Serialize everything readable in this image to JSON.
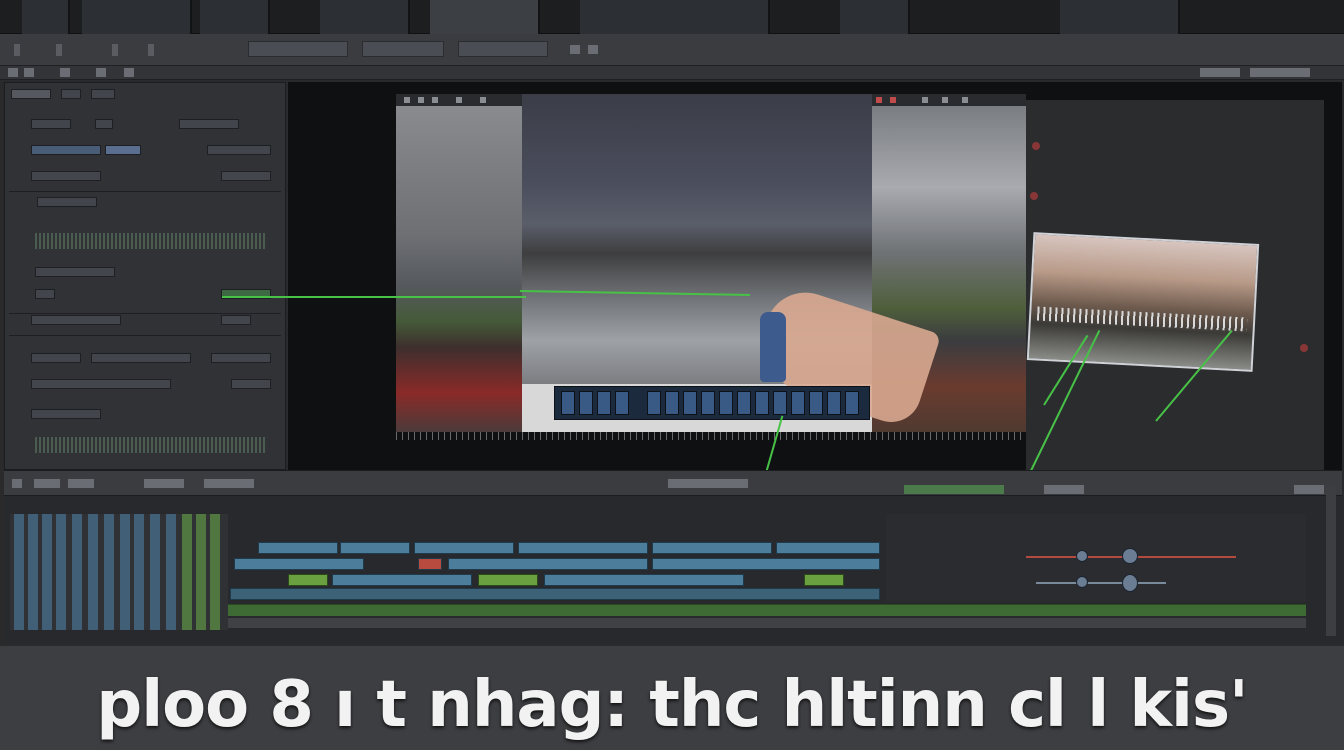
{
  "caption": {
    "text": "ploo 8 ı t nhag: thc hltinn cl  l kis'"
  },
  "menu": {
    "items": [
      "",
      "",
      "",
      ""
    ],
    "tabs": [
      "",
      "",
      ""
    ]
  },
  "viewer": {
    "clip_left_label": "",
    "clip_right_label": ""
  },
  "colors": {
    "accent_green": "#47c247",
    "clip_blue": "#4c7d9b",
    "clip_green": "#6aa040",
    "panel_bg": "#303236"
  },
  "icons": [
    "play-icon",
    "record-icon",
    "zoom-icon",
    "scroll-icon"
  ]
}
